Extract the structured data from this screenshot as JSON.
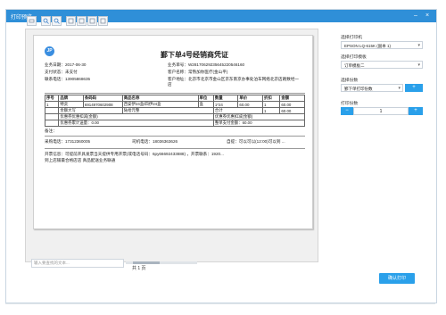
{
  "window": {
    "title": "打印预览"
  },
  "toolbar": {
    "icons": [
      "print-icon",
      "zoom-in-icon",
      "zoom-out-icon",
      "page-first-icon",
      "page-prev-icon",
      "page-next-icon",
      "page-last-icon"
    ]
  },
  "document": {
    "logo_text": "JP",
    "title": "鄞下单4号经销商凭证",
    "info": {
      "date": "业务日期：2017-06-30",
      "order_no": "业务单号：W2817062923564522054616​0",
      "pay_status": "支付状态：未支付",
      "customer": "客户名称：常熟加你医疗(金山平)",
      "phone": "联系电话：13905868635",
      "address": "客户地址：北京市北京市金山区京东南京办事处泊车网络北京店路数经一店"
    },
    "table": {
      "headers": [
        "序号",
        "品牌",
        "条码码",
        "商品名称",
        "单位",
        "数量",
        "单价",
        "折扣",
        "金额"
      ],
      "rows": [
        [
          "1",
          "特卖",
          "6914970602908",
          "西安伊24盒/四伊24盒",
          "盒",
          "1*24",
          "60.00",
          "1",
          "60.00"
        ],
        [
          "",
          "金额大写",
          "",
          "陆拾元整",
          "",
          "合计",
          "",
          "1",
          "60.00"
        ],
        [
          "",
          "优惠券优惠扣减(金额)",
          "",
          "",
          "",
          "优惠券优惠扣减(金额)",
          "",
          "",
          ""
        ],
        [
          "",
          "优惠券累计送量：0.00",
          "",
          "",
          "",
          "整单支付金额：60.00",
          "",
          "",
          ""
        ]
      ]
    },
    "remark": "备注：",
    "footer1": "采购电话：17312360005",
    "footer2": "司机电话：18036363626",
    "footer3": "自提：可以可以(12:00)可以到 ...",
    "footer4": "开票信息：可提前开具发票当天提供专用开票(或电话号码：6py66692433888) ，开票联系：1920...",
    "footer5": "到上店铺最合格店店        真品配送业务联通"
  },
  "pagebar": {
    "input_placeholder": "输入要查找的文本...",
    "page_info": "共 1 页"
  },
  "side": {
    "printer_label": "选择打印机",
    "printer_value": "EPSON LQ-615K (副本 1)",
    "template_label": "选择打印模板",
    "template_value": "订单模板二",
    "copies_label": "选择份数",
    "copies_value": "鄞下单打印份数",
    "count_label": "打印份数",
    "count_value": "1",
    "minus": "−",
    "plus": "+",
    "add_btn": "+"
  },
  "print_button": "确认打印",
  "colors": {
    "accent": "#2aa0ea",
    "title_bar": "#2f8fd8"
  }
}
